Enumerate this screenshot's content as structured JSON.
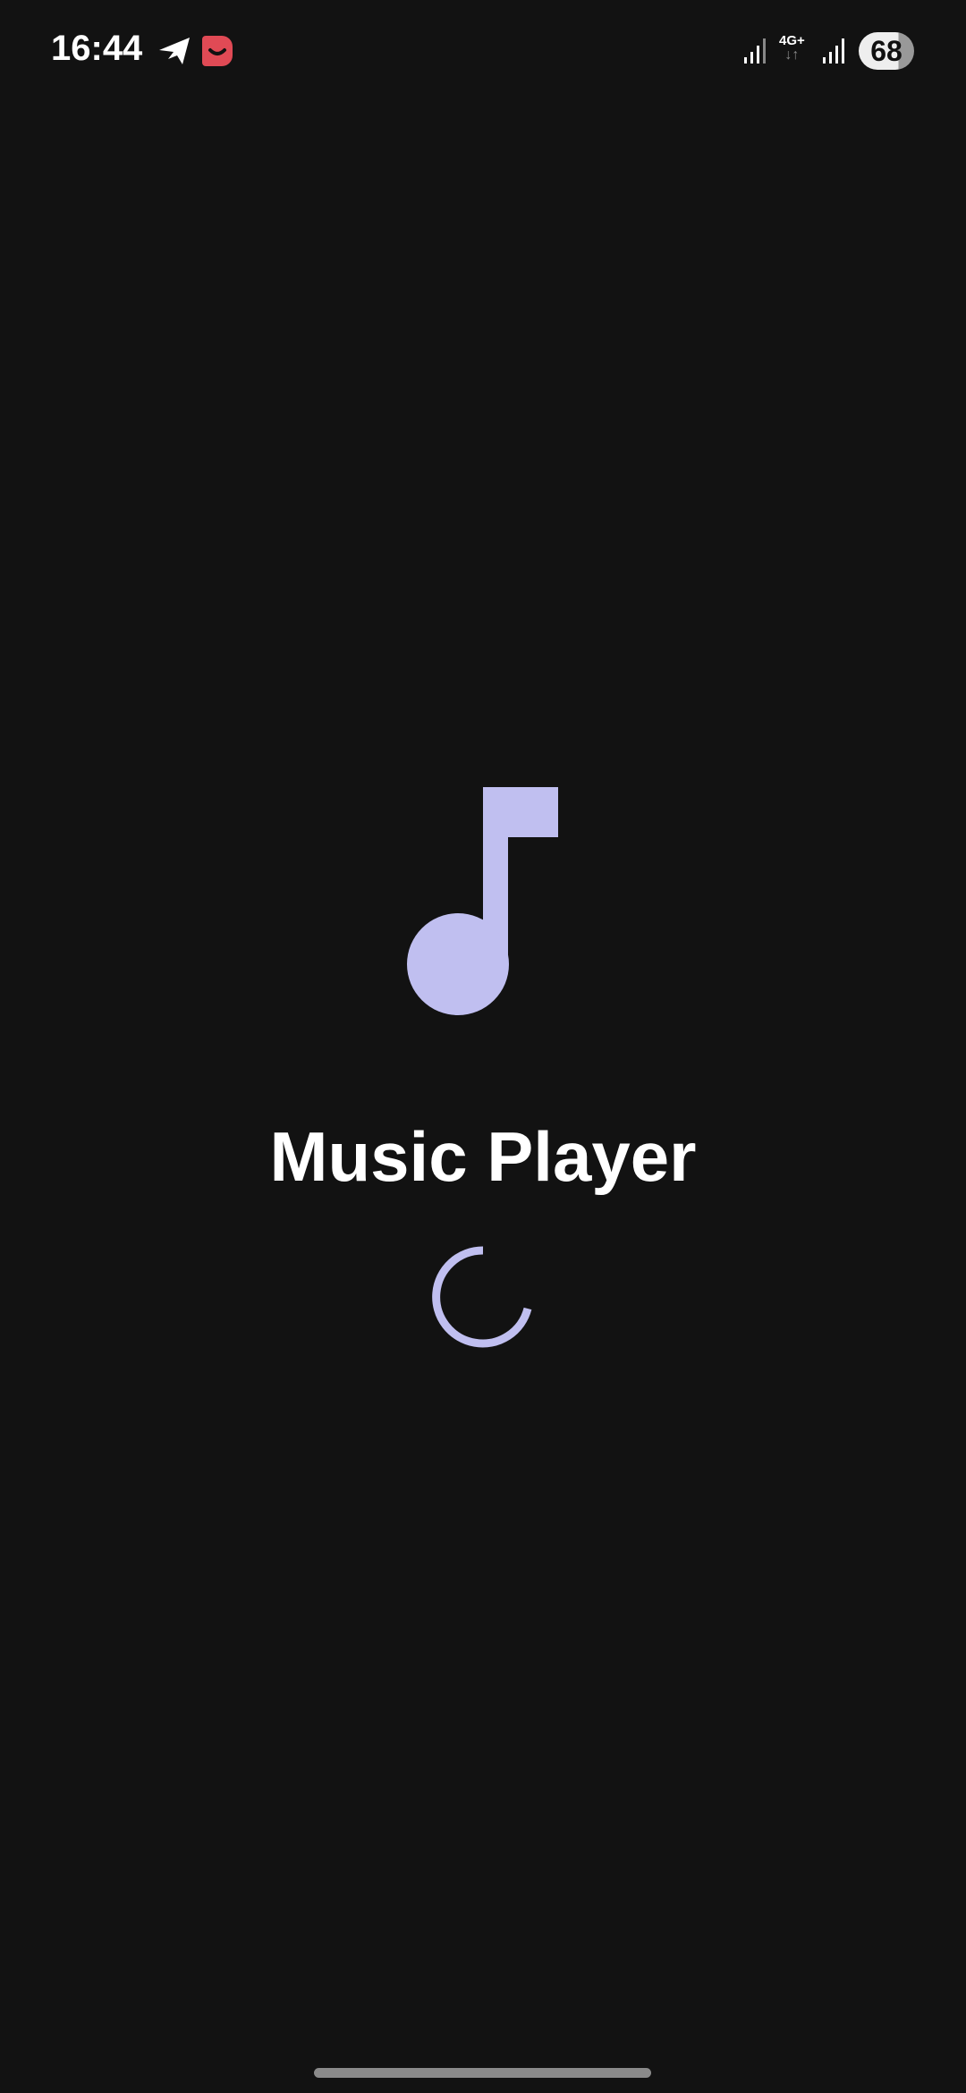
{
  "status_bar": {
    "time": "16:44",
    "network_type": "4G+",
    "battery_level": "68"
  },
  "splash": {
    "app_title": "Music Player",
    "accent_color": "#c0bff0"
  }
}
